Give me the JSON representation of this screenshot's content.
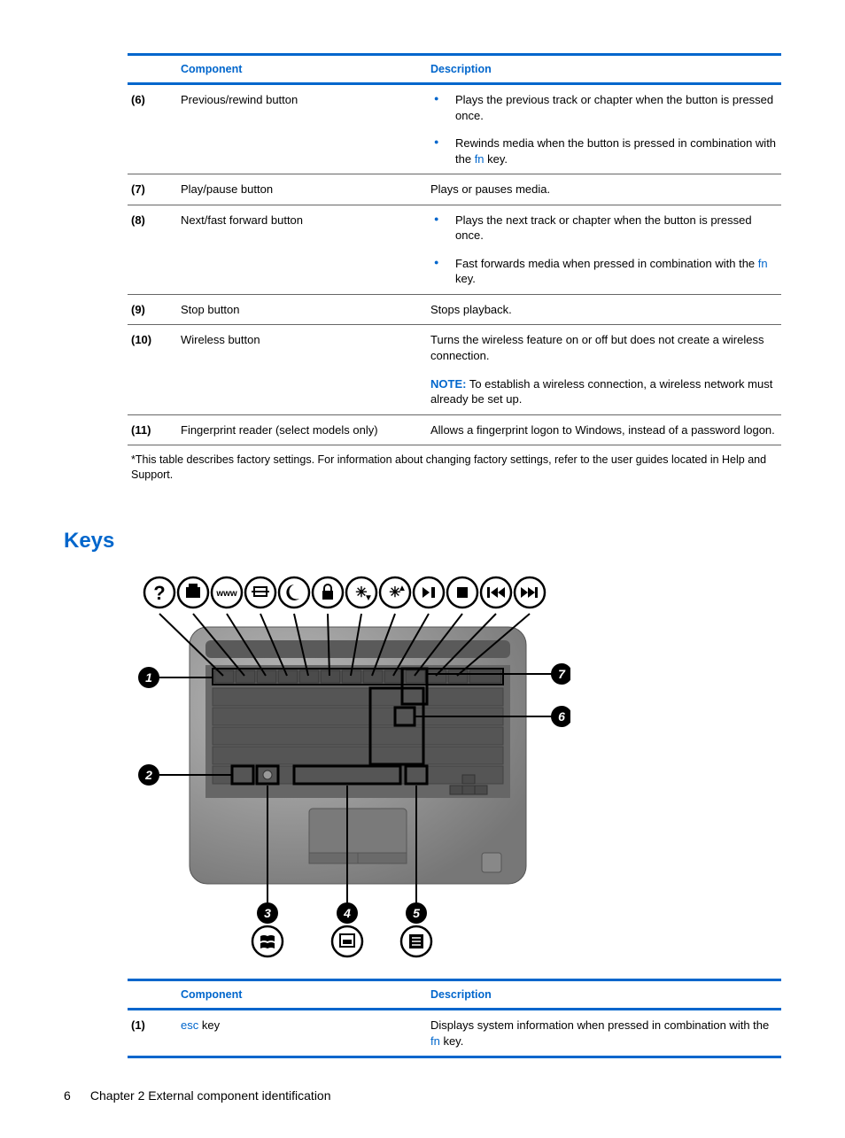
{
  "table1": {
    "headers": {
      "component": "Component",
      "description": "Description"
    },
    "rows": [
      {
        "num": "(6)",
        "comp": "Previous/rewind button",
        "bullets": [
          {
            "pre": "Plays the previous track or chapter when the button is pressed once."
          },
          {
            "pre": "Rewinds media when the button is pressed in combination with the ",
            "fn": "fn",
            "post": " key."
          }
        ]
      },
      {
        "num": "(7)",
        "comp": "Play/pause button",
        "text": "Plays or pauses media."
      },
      {
        "num": "(8)",
        "comp": "Next/fast forward button",
        "bullets": [
          {
            "pre": "Plays the next track or chapter when the button is pressed once."
          },
          {
            "pre": "Fast forwards media when pressed in combination with the ",
            "fn": "fn",
            "post": " key."
          }
        ]
      },
      {
        "num": "(9)",
        "comp": "Stop button",
        "text": "Stops playback."
      },
      {
        "num": "(10)",
        "comp": "Wireless button",
        "text": "Turns the wireless feature on or off but does not create a wireless connection.",
        "noteLabel": "NOTE:",
        "noteText": "   To establish a wireless connection, a wireless network must already be set up."
      },
      {
        "num": "(11)",
        "comp": "Fingerprint reader (select models only)",
        "text": "Allows a fingerprint logon to Windows, instead of a password logon."
      }
    ],
    "footnote": "*This table describes factory settings. For information about changing factory settings, refer to the user guides located in Help and Support."
  },
  "sectionHeading": "Keys",
  "diagram": {
    "callouts": [
      "1",
      "2",
      "3",
      "4",
      "5",
      "6",
      "7"
    ],
    "topIcons": [
      "help",
      "print",
      "www",
      "switch",
      "sleep",
      "lock",
      "brightness-down",
      "brightness-up",
      "play-pause",
      "stop",
      "prev",
      "next"
    ],
    "bottomIcons": [
      "windows",
      "app",
      "menu"
    ]
  },
  "table2": {
    "headers": {
      "component": "Component",
      "description": "Description"
    },
    "rows": [
      {
        "num": "(1)",
        "compLink": "esc",
        "compRest": " key",
        "descPre": "Displays system information when pressed in combination with the ",
        "descFn": "fn",
        "descPost": " key."
      }
    ]
  },
  "footer": {
    "pageNum": "6",
    "chapter": "Chapter 2   External component identification"
  }
}
